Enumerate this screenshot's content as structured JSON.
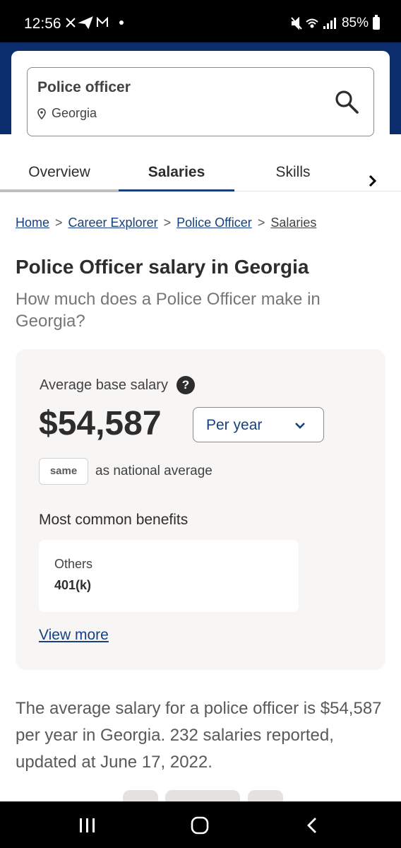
{
  "status_bar": {
    "time": "12:56",
    "notifications": "✖ ➤ M •",
    "signal_text": "⊘ ◔ .∥",
    "battery": "85%"
  },
  "search": {
    "job": "Police officer",
    "location": "Georgia"
  },
  "tabs": [
    {
      "label": "Overview"
    },
    {
      "label": "Salaries"
    },
    {
      "label": "Skills"
    }
  ],
  "breadcrumb": {
    "items": [
      "Home",
      "Career Explorer",
      "Police Officer",
      "Salaries"
    ],
    "separator": ">"
  },
  "page": {
    "title": "Police Officer salary in Georgia",
    "subtitle": "How much does a Police Officer make in Georgia?"
  },
  "salary_card": {
    "avg_label": "Average base salary",
    "help": "?",
    "amount": "$54,587",
    "period": "Per year",
    "badge": "same",
    "compare_text": "as national average",
    "benefits_title": "Most common benefits",
    "benefit_name": "Others",
    "benefit_value": "401(k)",
    "view_more": "View more"
  },
  "summary": "The average salary for a police officer is $54,587 per year in Georgia.  232 salaries reported, updated at June 17, 2022.",
  "colors": {
    "brand_navy": "#0b2d6b",
    "link_blue": "#164081",
    "card_bg": "#f7f6f5"
  }
}
